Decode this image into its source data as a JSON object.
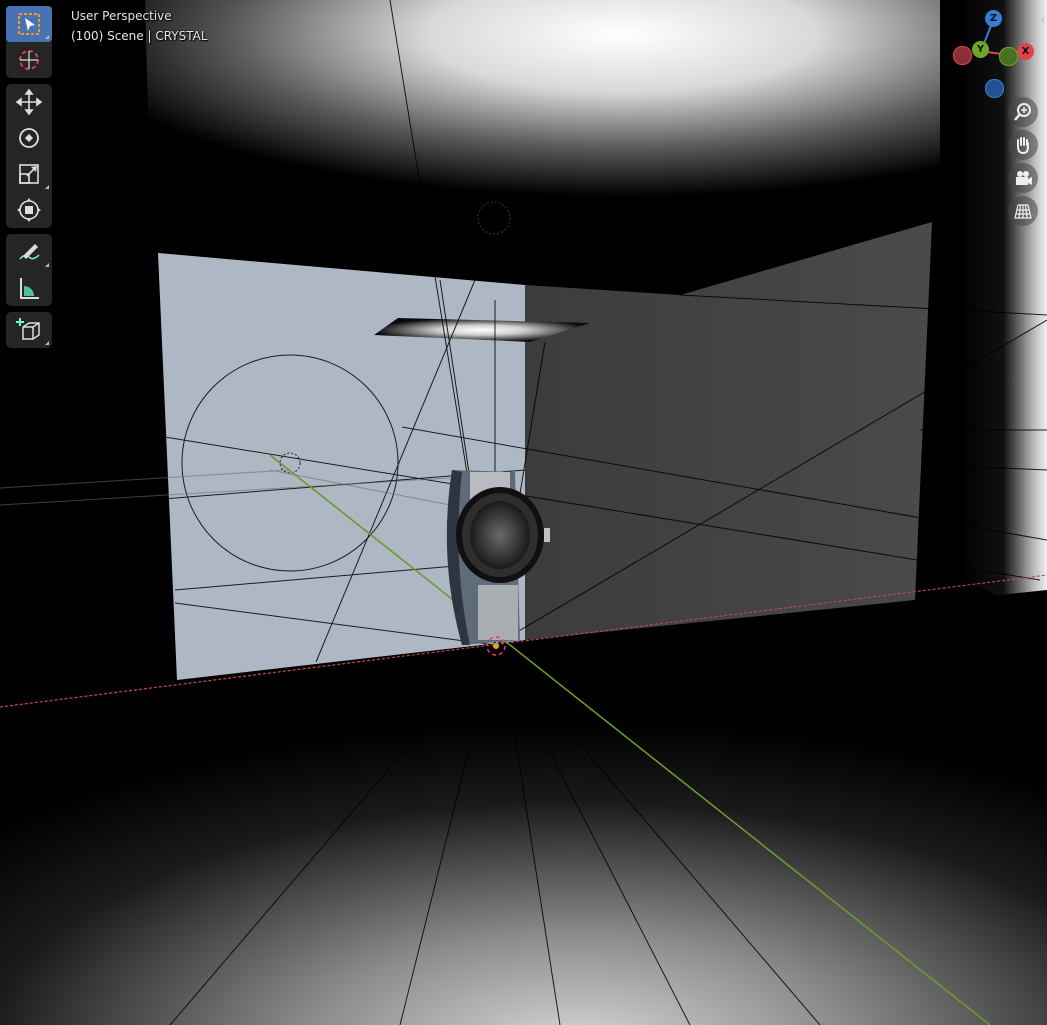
{
  "viewport": {
    "view_mode": "User Perspective",
    "scene_info": "(100) Scene | CRYSTAL"
  },
  "toolbar": {
    "tools": [
      {
        "name": "select-box",
        "icon": "select-box-icon",
        "active": true
      },
      {
        "name": "cursor",
        "icon": "cursor-icon",
        "active": false
      },
      {
        "name": "move",
        "icon": "move-icon",
        "active": false
      },
      {
        "name": "rotate",
        "icon": "rotate-icon",
        "active": false
      },
      {
        "name": "scale",
        "icon": "scale-icon",
        "active": false
      },
      {
        "name": "transform",
        "icon": "transform-icon",
        "active": false
      },
      {
        "name": "annotate",
        "icon": "annotate-icon",
        "active": false
      },
      {
        "name": "measure",
        "icon": "measure-icon",
        "active": false
      },
      {
        "name": "add-cube",
        "icon": "add-cube-icon",
        "active": false
      }
    ]
  },
  "gizmo": {
    "z_label": "Z",
    "y_label": "Y",
    "x_label": "X",
    "colors": {
      "x": "#e0434f",
      "y": "#6ea629",
      "z": "#3a7bd5"
    }
  },
  "nav": {
    "buttons": [
      "zoom-icon",
      "hand-icon",
      "camera-icon",
      "grid-icon"
    ]
  },
  "colors": {
    "active_tool": "#4772b3",
    "x_axis_line": "#c24456",
    "y_axis_line": "#6b9b2c",
    "accent": "#4772b3"
  }
}
